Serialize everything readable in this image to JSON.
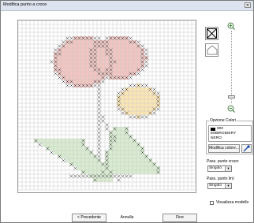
{
  "window": {
    "title": "Modifica punto a croce",
    "close_glyph": "✕"
  },
  "tools": {
    "cross_tool": "cross-stitch-tool-icon",
    "home_tool": "home-icon",
    "zoom_in": "zoom-in-icon",
    "zoom_out": "zoom-out-icon"
  },
  "color_options": {
    "title": "Opzione Colori",
    "swatch_color": "#000000",
    "code": "900",
    "brand": "EMBROIDERY",
    "name": "NERO",
    "modify_button": "Modifica colore...",
    "picker_icon": "eyedropper-icon"
  },
  "cross_stitch": {
    "label": "Pass. punto croce:",
    "value": "Singolo"
  },
  "line_stitch": {
    "label": "Pass. punto linì:",
    "value": "Singolo"
  },
  "show_model": {
    "label": "Visualizza modello",
    "checked": false
  },
  "footer": {
    "prev": "< Precedente",
    "cancel": "Annulla",
    "finish": "Fine"
  },
  "palette": {
    "pink": "#f3c4c0",
    "yellow": "#fbe5b4",
    "green": "#d8ecd0",
    "grid": "#c9c9c9",
    "stitch": "#333333"
  }
}
